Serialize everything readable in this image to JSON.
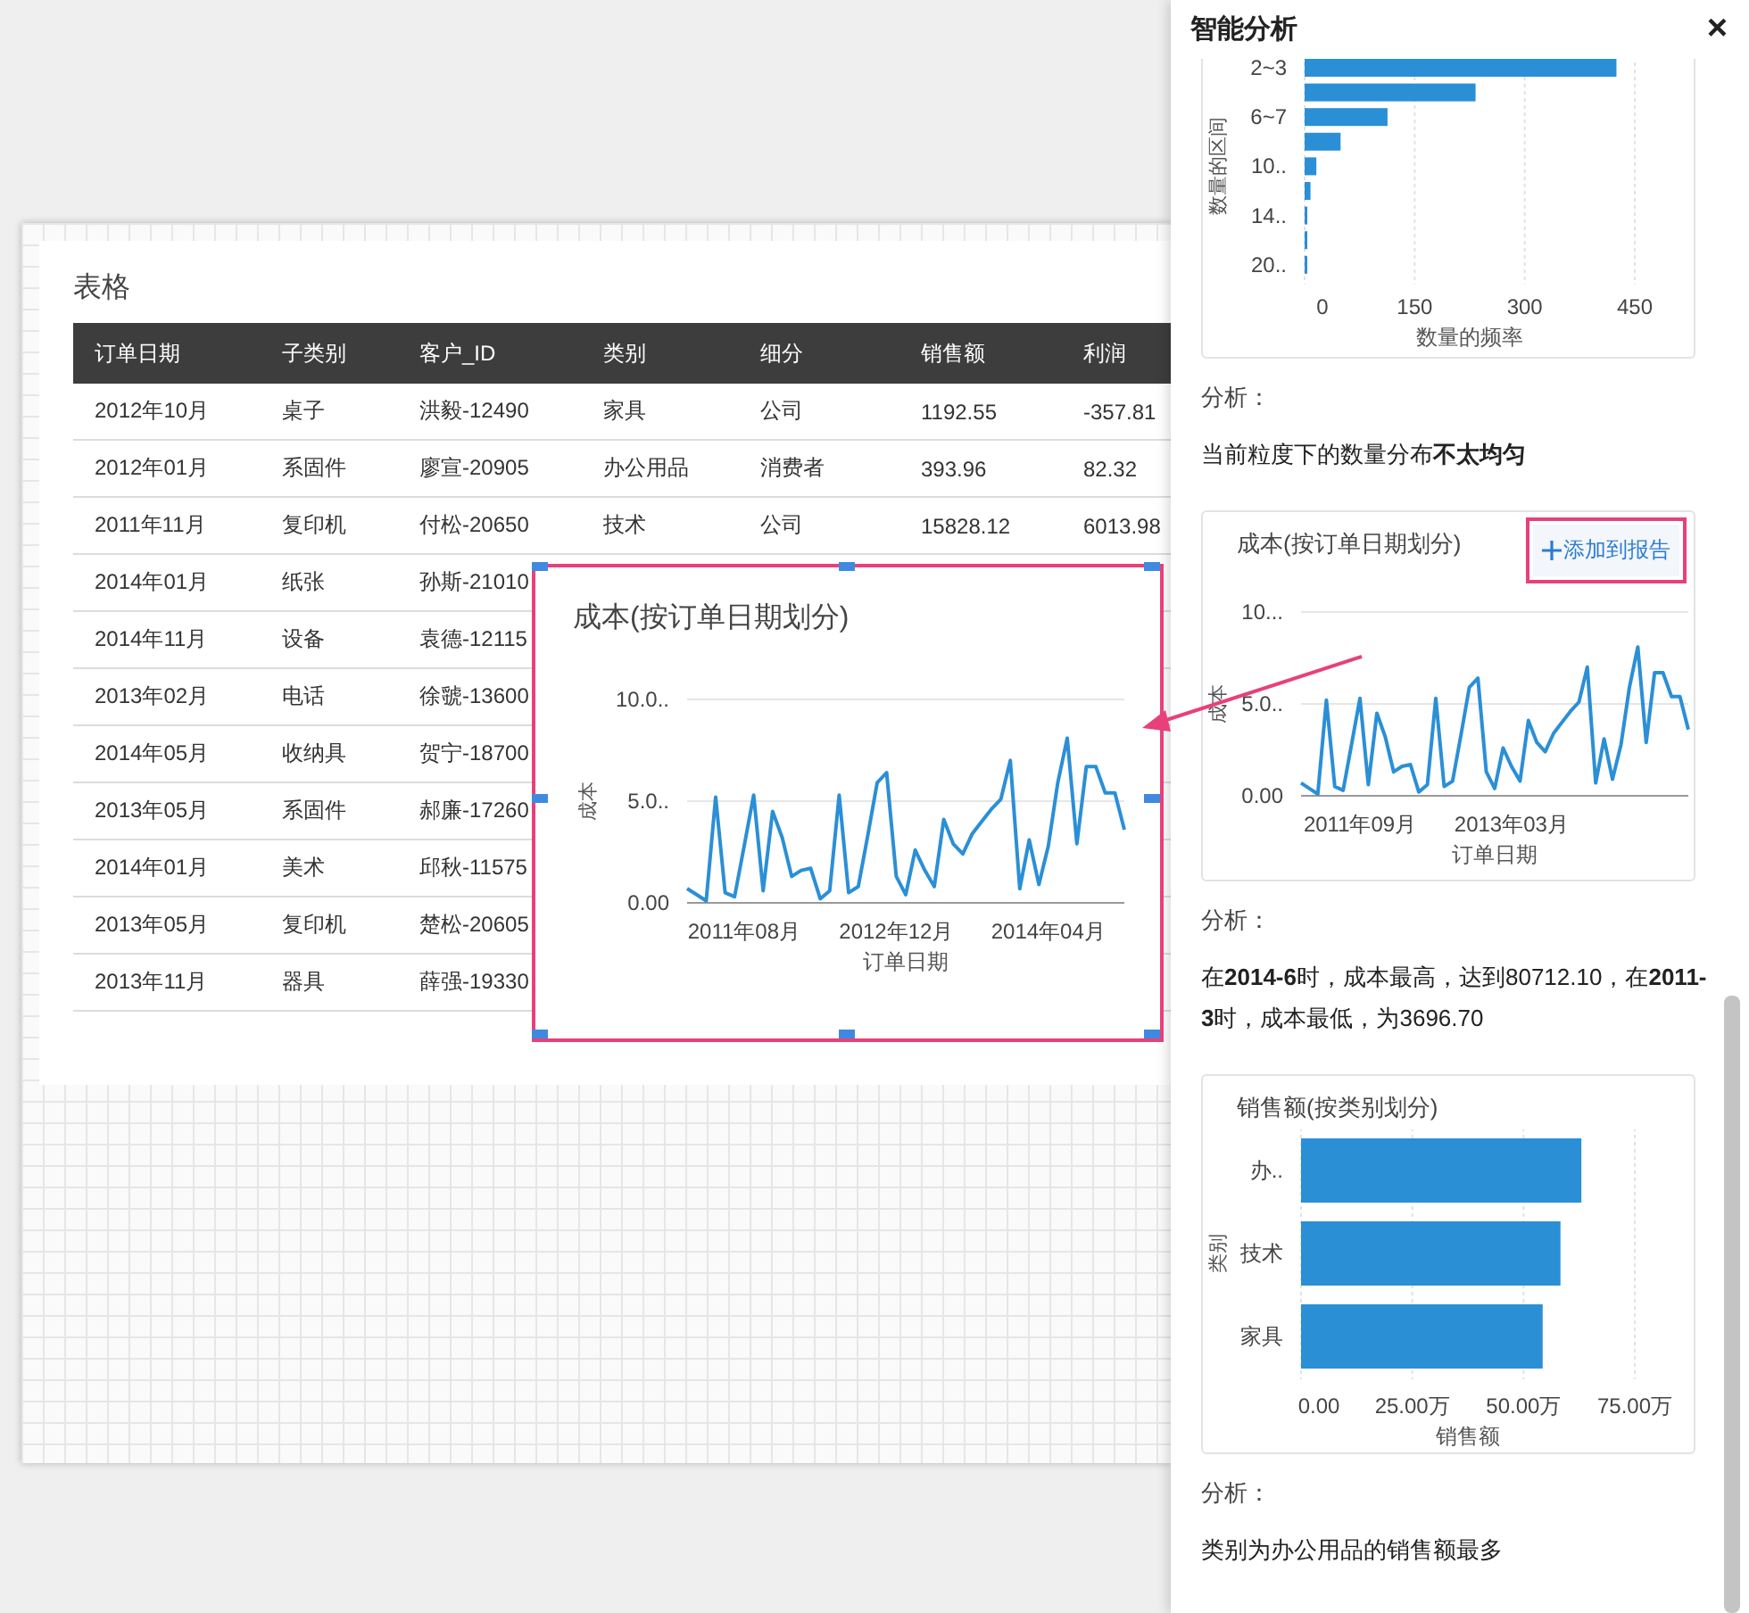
{
  "canvas": {
    "table_widget": {
      "title": "表格",
      "columns": [
        "订单日期",
        "子类别",
        "客户_ID",
        "类别",
        "细分",
        "销售额",
        "利润"
      ],
      "rows": [
        [
          "2012年10月",
          "桌子",
          "洪毅-12490",
          "家具",
          "公司",
          "1192.55",
          "-357.81"
        ],
        [
          "2012年01月",
          "系固件",
          "廖宣-20905",
          "办公用品",
          "消费者",
          "393.96",
          "82.32"
        ],
        [
          "2011年11月",
          "复印机",
          "付松-20650",
          "技术",
          "公司",
          "15828.12",
          "6013.98"
        ],
        [
          "2014年01月",
          "纸张",
          "孙斯-21010"
        ],
        [
          "2014年11月",
          "设备",
          "袁德-12115"
        ],
        [
          "2013年02月",
          "电话",
          "徐虢-13600"
        ],
        [
          "2014年05月",
          "收纳具",
          "贺宁-18700"
        ],
        [
          "2013年05月",
          "系固件",
          "郝廉-17260"
        ],
        [
          "2014年01月",
          "美术",
          "邱秋-11575"
        ],
        [
          "2013年05月",
          "复印机",
          "楚松-20605"
        ],
        [
          "2013年11月",
          "器具",
          "薛强-19330"
        ]
      ]
    },
    "floating_chart": {
      "chart_data": {
        "type": "line",
        "title": "成本(按订单日期划分)",
        "xlabel": "订单日期",
        "ylabel": "成本",
        "ylim": [
          0,
          10
        ],
        "yticks": [
          {
            "value": 0,
            "label": "0.00"
          },
          {
            "value": 5,
            "label": "5.0.."
          },
          {
            "value": 10,
            "label": "10.0.."
          }
        ],
        "categories": [
          null,
          null,
          null,
          null,
          null,
          null,
          "2011年08月",
          null,
          null,
          null,
          null,
          null,
          null,
          null,
          null,
          null,
          null,
          null,
          null,
          null,
          null,
          null,
          "2012年12月",
          null,
          null,
          null,
          null,
          null,
          null,
          null,
          null,
          null,
          null,
          null,
          null,
          null,
          null,
          null,
          "2014年04月",
          null,
          null,
          null,
          null,
          null,
          null,
          null,
          null
        ],
        "series": [
          {
            "color": "#2b8fd6",
            "values": [
              0.7,
              0.4,
              0.1,
              5.2,
              0.5,
              0.3,
              2.8,
              5.3,
              0.6,
              4.5,
              3.2,
              1.3,
              1.6,
              1.7,
              0.2,
              0.6,
              5.3,
              0.5,
              0.8,
              3.3,
              5.9,
              6.4,
              1.3,
              0.4,
              2.6,
              1.6,
              0.8,
              4.1,
              2.9,
              2.4,
              3.4,
              4.0,
              4.6,
              5.1,
              7.0,
              0.7,
              3.1,
              0.9,
              2.8,
              5.9,
              8.1,
              2.9,
              6.7,
              6.7,
              5.4,
              5.4,
              3.6
            ]
          }
        ]
      }
    }
  },
  "panel": {
    "title": "智能分析",
    "close": "×",
    "cards": [
      {
        "chart_data": {
          "type": "bar",
          "orientation": "horizontal",
          "xlabel": "数量的频率",
          "ylabel": "数量的区间",
          "categories": [
            "2~3",
            null,
            "6~7",
            null,
            "10..",
            null,
            "14..",
            null,
            "20.."
          ],
          "xlim": [
            0,
            450
          ],
          "xticks": [
            0,
            150,
            300,
            450
          ],
          "series": [
            {
              "color": "#2b8fd6",
              "values": [
                425,
                233,
                113,
                49,
                16,
                8,
                2,
                1,
                1
              ]
            }
          ]
        },
        "analysis_label": "分析：",
        "analysis": "当前粒度下的数量分布**不太均匀**"
      },
      {
        "chart_data": {
          "type": "line",
          "title": "成本(按订单日期划分)",
          "xlabel": "订单日期",
          "ylabel": "成本",
          "ylim": [
            0,
            10
          ],
          "yticks": [
            {
              "value": 0,
              "label": "0.00"
            },
            {
              "value": 5,
              "label": "5.0.."
            },
            {
              "value": 10,
              "label": "10..."
            }
          ],
          "categories": [
            null,
            null,
            null,
            null,
            null,
            null,
            null,
            "2011年09月",
            null,
            null,
            null,
            null,
            null,
            null,
            null,
            null,
            null,
            null,
            null,
            null,
            null,
            null,
            null,
            null,
            null,
            "2013年03月",
            null,
            null,
            null,
            null,
            null,
            null,
            null,
            null,
            null,
            null,
            null,
            null,
            null,
            null,
            null,
            null,
            null,
            null,
            null,
            null,
            null
          ],
          "series": [
            {
              "color": "#2b8fd6",
              "values": [
                0.7,
                0.4,
                0.1,
                5.2,
                0.5,
                0.3,
                2.8,
                5.3,
                0.6,
                4.5,
                3.2,
                1.3,
                1.6,
                1.7,
                0.2,
                0.6,
                5.3,
                0.5,
                0.8,
                3.3,
                5.9,
                6.4,
                1.3,
                0.4,
                2.6,
                1.6,
                0.8,
                4.1,
                2.9,
                2.4,
                3.4,
                4.0,
                4.6,
                5.1,
                7.0,
                0.7,
                3.1,
                0.9,
                2.8,
                5.9,
                8.1,
                2.9,
                6.7,
                6.7,
                5.4,
                5.4,
                3.6
              ]
            }
          ]
        },
        "action": "添加到报告",
        "action_highlighted": true,
        "analysis_label": "分析：",
        "analysis": "在**2014-6**时，成本最高，达到80712.10，在**2011-3**时，成本最低，为3696.70"
      },
      {
        "chart_data": {
          "type": "bar",
          "orientation": "horizontal",
          "title": "销售额(按类别划分)",
          "xlabel": "销售额",
          "ylabel": "类别",
          "categories": [
            "办..",
            "技术",
            "家具"
          ],
          "xlim": [
            0,
            75
          ],
          "xticks": [
            {
              "value": 0,
              "label": "0.00"
            },
            {
              "value": 25,
              "label": "25.00万"
            },
            {
              "value": 50,
              "label": "50.00万"
            },
            {
              "value": 75,
              "label": "75.00万"
            }
          ],
          "series": [
            {
              "color": "#2b8fd6",
              "values": [
                63,
                58.3,
                54.3
              ]
            }
          ]
        },
        "analysis_label": "分析：",
        "analysis": "类别为办公用品的销售额最多"
      }
    ]
  }
}
